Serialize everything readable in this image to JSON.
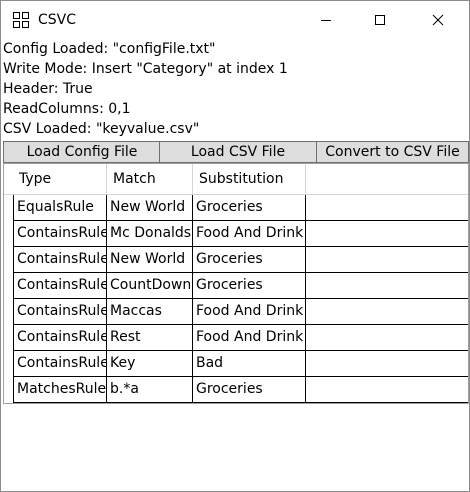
{
  "window": {
    "title": "CSVC",
    "icon": "grid-app-icon",
    "controls": [
      "minimize-icon",
      "maximize-icon",
      "close-icon"
    ]
  },
  "status": {
    "config_loaded": "Config Loaded: \"configFile.txt\"",
    "write_mode": "Write Mode: Insert \"Category\" at index 1",
    "header": "Header: True",
    "read_columns": "ReadColumns: 0,1",
    "csv_loaded": "CSV Loaded: \"keyvalue.csv\""
  },
  "toolbar": {
    "load_config_label": "Load Config File",
    "load_csv_label": "Load CSV File",
    "convert_label": "Convert to CSV File"
  },
  "grid": {
    "columns": [
      "Type",
      "Match",
      "Substitution",
      ""
    ],
    "rows": [
      {
        "type": "EqualsRule",
        "match": "New World",
        "substitution": "Groceries"
      },
      {
        "type": "ContainsRule",
        "match": "Mc Donalds",
        "substitution": "Food And Drink"
      },
      {
        "type": "ContainsRule",
        "match": "New World",
        "substitution": "Groceries"
      },
      {
        "type": "ContainsRule",
        "match": "CountDown",
        "substitution": "Groceries"
      },
      {
        "type": "ContainsRule",
        "match": "Maccas",
        "substitution": "Food And Drink"
      },
      {
        "type": "ContainsRule",
        "match": "Rest",
        "substitution": "Food And Drink"
      },
      {
        "type": "ContainsRule",
        "match": "Key",
        "substitution": "Bad"
      },
      {
        "type": "MatchesRule",
        "match": "b.*a",
        "substitution": "Groceries"
      }
    ]
  }
}
